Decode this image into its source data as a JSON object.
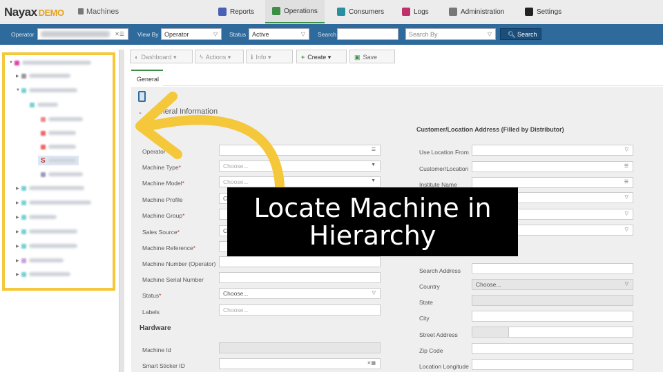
{
  "header": {
    "logo": "Nayax",
    "logo_suffix": "DEMO",
    "app_name": "Machines",
    "tabs": [
      {
        "label": "Reports",
        "color": "#4a5fb5"
      },
      {
        "label": "Operations",
        "color": "#3d8f44"
      },
      {
        "label": "Consumers",
        "color": "#2a8fa0"
      },
      {
        "label": "Logs",
        "color": "#c0306a"
      },
      {
        "label": "Administration",
        "color": "#777777"
      },
      {
        "label": "Settings",
        "color": "#222222"
      }
    ],
    "active_tab": "Operations"
  },
  "filters": {
    "operator_label": "Operator",
    "view_by_label": "View By",
    "view_by_value": "Operator",
    "status_label": "Status",
    "status_value": "Active",
    "search_label": "Search",
    "search_value": "",
    "search_by_placeholder": "Search By",
    "search_button": "Search"
  },
  "toolbar": {
    "dashboard": "Dashboard",
    "actions": "Actions",
    "info": "Info",
    "create": "Create",
    "save": "Save"
  },
  "tabs": {
    "general": "General"
  },
  "form": {
    "section_title": "General Information",
    "left_fields": [
      {
        "label": "Operator",
        "required": true,
        "value": "",
        "type": "list"
      },
      {
        "label": "Machine Type",
        "required": true,
        "value": "Choose...",
        "type": "select"
      },
      {
        "label": "Machine Model",
        "required": true,
        "value": "Choose...",
        "type": "select"
      },
      {
        "label": "Machine Profile",
        "required": false,
        "value": "C",
        "type": "text"
      },
      {
        "label": "Machine Group",
        "required": true,
        "value": "",
        "type": "text"
      },
      {
        "label": "Sales Source",
        "required": true,
        "value": "C",
        "type": "text"
      },
      {
        "label": "Machine Reference",
        "required": true,
        "value": "",
        "type": "text"
      },
      {
        "label": "Machine Number (Operator)",
        "required": false,
        "value": "",
        "type": "text"
      },
      {
        "label": "Machine Serial Number",
        "required": false,
        "value": "",
        "type": "text"
      },
      {
        "label": "Status",
        "required": true,
        "value": "Choose...",
        "type": "select"
      },
      {
        "label": "Labels",
        "required": false,
        "value": "Choose...",
        "type": "text"
      }
    ],
    "hardware_title": "Hardware",
    "hardware_fields": [
      {
        "label": "Machine Id",
        "value": ""
      },
      {
        "label": "Smart Sticker ID",
        "value": ""
      }
    ],
    "customer_title": "Customer/Location Address (Filled by Distributor)",
    "right_fields": [
      {
        "label": "Use Location From",
        "value": "",
        "type": "select"
      },
      {
        "label": "Customer/Location",
        "value": "",
        "type": "list"
      },
      {
        "label": "Institute Name",
        "value": "",
        "type": "list"
      },
      {
        "label": "",
        "value": "",
        "type": "select"
      },
      {
        "label": "",
        "value": "",
        "type": "select"
      },
      {
        "label": "",
        "value": "",
        "type": "select"
      },
      {
        "label": "Search Address",
        "value": "",
        "type": "text"
      },
      {
        "label": "Country",
        "value": "Choose...",
        "type": "select"
      },
      {
        "label": "State",
        "value": "",
        "type": "disabled"
      },
      {
        "label": "City",
        "value": "",
        "type": "text"
      },
      {
        "label": "Street Address",
        "value": "",
        "type": "text"
      },
      {
        "label": "Zip Code",
        "value": "",
        "type": "text"
      },
      {
        "label": "Location Longitude",
        "value": "",
        "type": "text"
      }
    ]
  },
  "overlay": {
    "caption_line1": "Locate Machine in",
    "caption_line2": "Hierarchy",
    "highlight_color": "#f5c73a"
  }
}
